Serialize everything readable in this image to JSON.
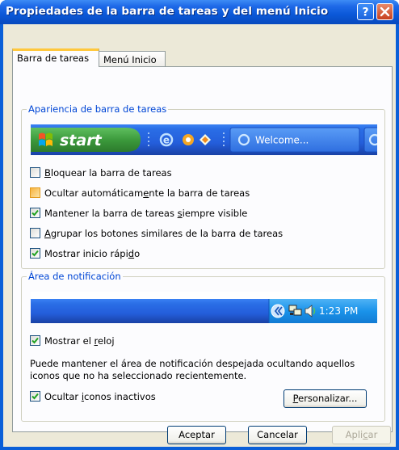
{
  "window": {
    "title": "Propiedades de la barra de tareas y del menú Inicio"
  },
  "tabs": [
    {
      "label": "Barra de tareas",
      "active": true
    },
    {
      "label": "Menú Inicio",
      "active": false
    }
  ],
  "appearance_group": {
    "title": "Apariencia de barra de tareas",
    "preview": {
      "start_label": "start",
      "window_button_label": "Welcome..."
    },
    "options": [
      {
        "pre": "",
        "u": "B",
        "post": "loquear la barra de tareas",
        "checked": false
      },
      {
        "pre": "Ocultar automáticamente la barra de tareas",
        "u": "",
        "post": "",
        "checked": false
      },
      {
        "pre": "Mantener la barra de tareas ",
        "u": "s",
        "post": "iempre visible",
        "checked": true
      },
      {
        "pre": "",
        "u": "A",
        "post": "grupar los botones similares de la barra de tareas",
        "checked": false
      },
      {
        "pre": "Mostrar inicio rápi",
        "u": "d",
        "post": "o",
        "checked": true
      }
    ]
  },
  "notification_group": {
    "title": "Área de notificación",
    "preview": {
      "clock": "1:23 PM"
    },
    "show_clock": {
      "pre": "Mostrar el ",
      "u": "r",
      "post": "eloj",
      "checked": true
    },
    "description": "Puede mantener el área de notificación despejada ocultando aquellos iconos que no ha seleccionado recientemente.",
    "hide_inactive": {
      "pre": "Ocultar ",
      "u": "i",
      "post": "conos inactivos",
      "checked": true
    },
    "customize_button": {
      "u": "P",
      "post": "ersonalizar..."
    }
  },
  "footer": {
    "ok_label": "Aceptar",
    "cancel_label": "Cancelar",
    "apply_pre": "Apli",
    "apply_u": "c",
    "apply_post": "ar",
    "apply_enabled": false
  },
  "colors": {
    "title_bar": "#0a58d8",
    "start_button": "#3c9a3c",
    "taskbar": "#245edb",
    "group_title": "#0046d5",
    "dialog_background": "#ece9d8"
  },
  "icons": [
    "help-icon",
    "close-icon",
    "windows-logo-icon",
    "ie-icon",
    "media-player-icon",
    "show-desktop-icon",
    "chevron-left-icon",
    "network-icon",
    "volume-icon",
    "checkmark-icon"
  ]
}
